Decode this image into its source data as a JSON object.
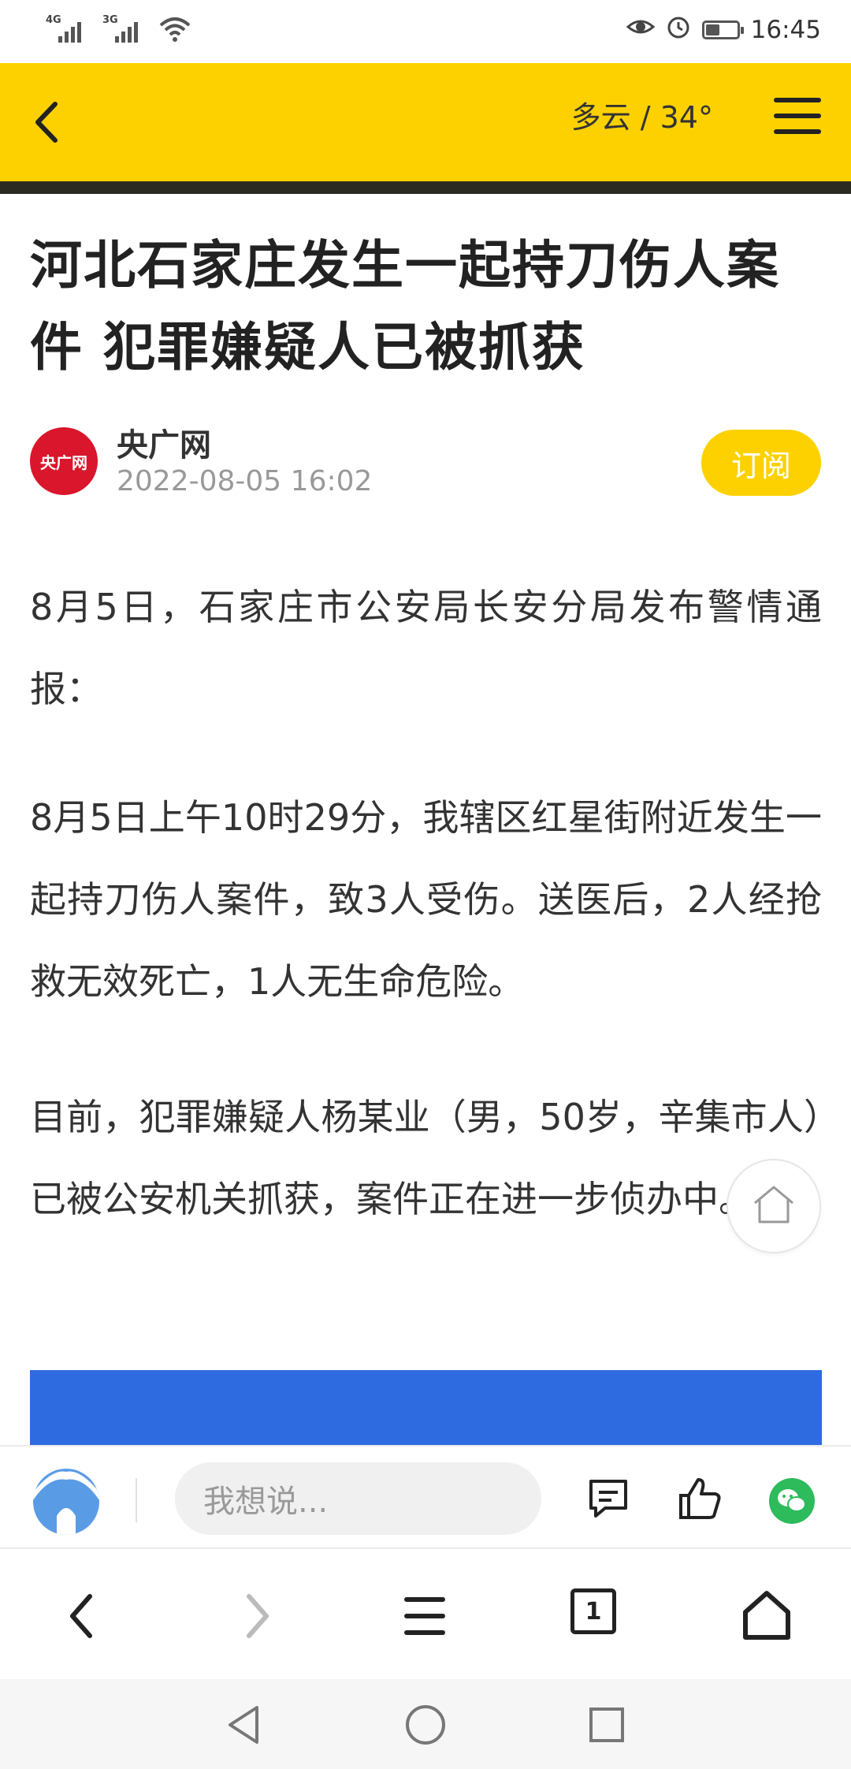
{
  "status_bar": {
    "signal_1": "4G",
    "signal_2": "3G",
    "time": "16:45",
    "icons": [
      "eye-icon",
      "alarm-icon",
      "battery-icon"
    ],
    "battery_level": 0.45
  },
  "header": {
    "weather": "多云 / 34°",
    "accent_color": "#fdd100",
    "icons": [
      "back-arrow-icon",
      "hamburger-menu-icon"
    ]
  },
  "article": {
    "title": "河北石家庄发生一起持刀伤人案件 犯罪嫌疑人已被抓获",
    "source": {
      "logo_text": "央广网",
      "name": "央广网",
      "date": "2022-08-05 16:02",
      "subscribe_label": "订阅"
    },
    "paragraphs": [
      "8月5日，石家庄市公安局长安分局发布警情通报：",
      "8月5日上午10时29分，我辖区红星街附近发生一起持刀伤人案件，致3人受伤。送医后，2人经抢救无效死亡，1人无生命危险。",
      "目前，犯罪嫌疑人杨某业（男，50岁，辛集市人）已被公安机关抓获，案件正在进一步侦办中。"
    ]
  },
  "comment_bar": {
    "placeholder": "我想说...",
    "icons": [
      "comment-icon",
      "thumbs-up-icon",
      "wechat-icon"
    ]
  },
  "browser_nav": {
    "tab_count": "1",
    "icons": [
      "back-icon",
      "forward-icon",
      "menu-icon",
      "tabs-icon",
      "home-icon"
    ]
  },
  "system_nav": {
    "icons": [
      "back-triangle-icon",
      "home-circle-icon",
      "recents-square-icon"
    ]
  }
}
